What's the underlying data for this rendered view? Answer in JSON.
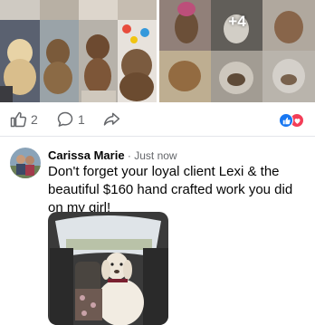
{
  "post": {
    "extra_photos_label": "+4",
    "like_count": "2",
    "comment_count": "1"
  },
  "icons": {
    "like": "thumbs-up-icon",
    "comment": "comment-bubble-icon",
    "share": "share-arrow-icon",
    "reactions": [
      "like-reaction-icon",
      "love-reaction-icon"
    ]
  },
  "comment": {
    "author": "Carissa Marie",
    "separator": " · ",
    "time": "Just now",
    "text": "Don't forget your loyal client Lexi & the beautiful $160 hand crafted work you did on my girl!"
  },
  "colors": {
    "accent_blue": "#1877f2",
    "love_red": "#f33e58",
    "secondary_text": "#65676b",
    "divider": "#e4e6eb"
  }
}
